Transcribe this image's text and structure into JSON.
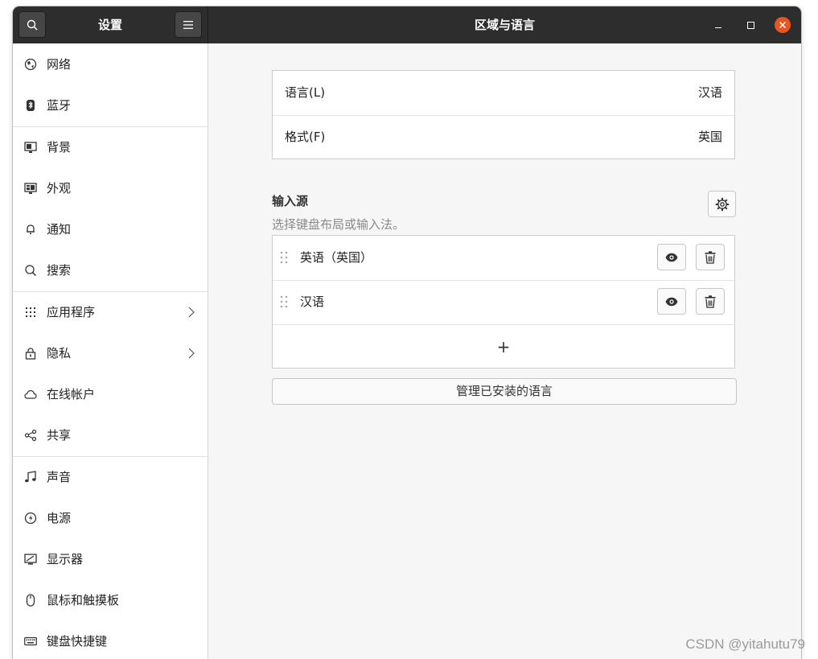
{
  "window": {
    "sidebar_title": "设置",
    "title": "区域与语言",
    "accent_close": "#e95420"
  },
  "sidebar": {
    "items": [
      {
        "label": "网络",
        "icon": "network-globe-icon"
      },
      {
        "label": "蓝牙",
        "icon": "bluetooth-icon"
      },
      {
        "label": "背景",
        "icon": "background-monitor-icon"
      },
      {
        "label": "外观",
        "icon": "appearance-monitor-icon"
      },
      {
        "label": "通知",
        "icon": "bell-icon"
      },
      {
        "label": "搜索",
        "icon": "search-icon"
      },
      {
        "label": "应用程序",
        "icon": "apps-grid-icon",
        "chevron": true
      },
      {
        "label": "隐私",
        "icon": "lock-icon",
        "chevron": true
      },
      {
        "label": "在线帐户",
        "icon": "cloud-icon"
      },
      {
        "label": "共享",
        "icon": "share-icon"
      },
      {
        "label": "声音",
        "icon": "music-note-icon"
      },
      {
        "label": "电源",
        "icon": "power-icon"
      },
      {
        "label": "显示器",
        "icon": "display-icon"
      },
      {
        "label": "鼠标和触摸板",
        "icon": "mouse-icon"
      },
      {
        "label": "键盘快捷键",
        "icon": "keyboard-icon"
      }
    ]
  },
  "main": {
    "language_label": "语言(L)",
    "language_value": "汉语",
    "format_label": "格式(F)",
    "format_value": "英国",
    "input_sources_title": "输入源",
    "input_sources_subtitle": "选择键盘布局或输入法。",
    "input_sources": [
      {
        "label": "英语（英国）"
      },
      {
        "label": "汉语"
      }
    ],
    "add_label": "+",
    "manage_button": "管理已安装的语言"
  },
  "watermark": "CSDN @yitahutu79"
}
